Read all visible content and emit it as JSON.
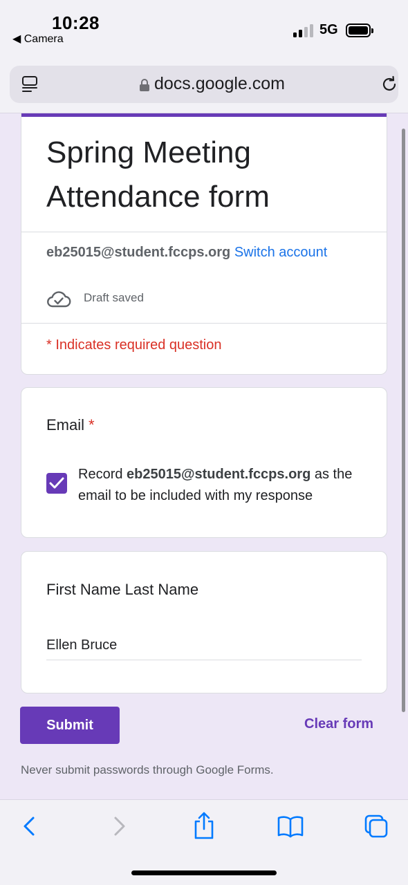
{
  "status_bar": {
    "time": "10:28",
    "back_label": "◀ Camera",
    "network": "5G"
  },
  "browser": {
    "url": "docs.google.com"
  },
  "form": {
    "title": "Spring Meeting Attendance form",
    "account_email": "eb25015@student.fccps.org",
    "switch_account": "Switch account",
    "draft_status": "Draft saved",
    "required_note": "* Indicates required question"
  },
  "questions": {
    "email": {
      "title": "Email",
      "required_marker": "*",
      "checked": true,
      "record_prefix": "Record",
      "record_email": "eb25015@student.fccps.org",
      "record_suffix": "as the email to be included with my response"
    },
    "name": {
      "title": "First Name Last Name",
      "answer": "Ellen Bruce"
    }
  },
  "actions": {
    "submit": "Submit",
    "clear": "Clear form"
  },
  "footer": {
    "warning": "Never submit passwords through Google Forms."
  },
  "colors": {
    "accent": "#673ab7",
    "link": "#1a73e8",
    "required": "#d93025",
    "ios_blue": "#007aff"
  },
  "toolbar_icons": [
    "back-icon",
    "forward-icon",
    "share-icon",
    "bookmarks-icon",
    "tabs-icon"
  ]
}
